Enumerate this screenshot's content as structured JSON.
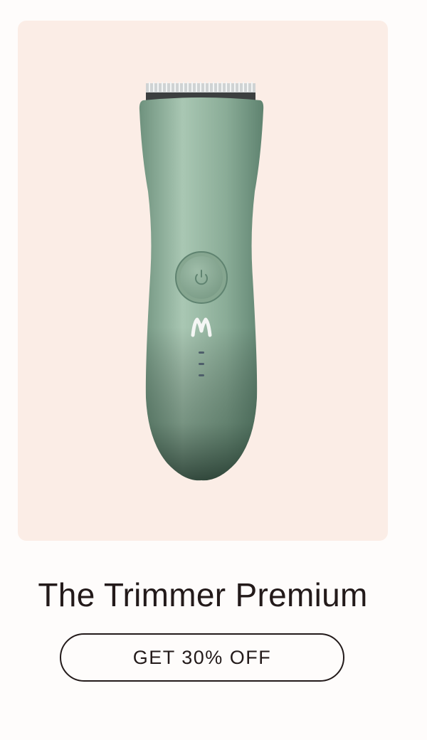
{
  "product": {
    "title": "The Trimmer Premium",
    "image_icon": "trimmer-icon",
    "card_background": "#fbede6",
    "body_color": "#8fb09a"
  },
  "cta": {
    "label": "GET 30% OFF"
  },
  "colors": {
    "page_background": "#fefcfb",
    "text": "#231a1a"
  }
}
